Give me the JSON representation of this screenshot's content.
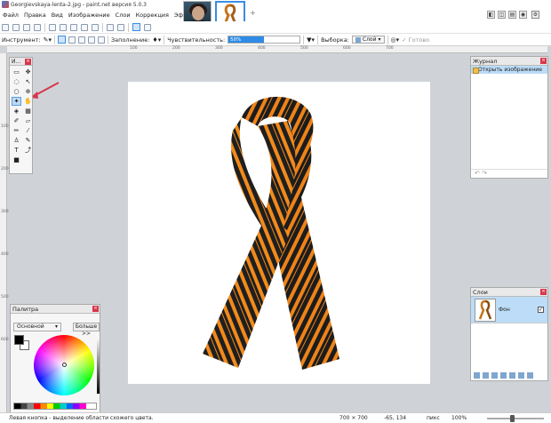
{
  "window": {
    "title": "Georgievskaya-lenta-2.jpg - paint.net версия 5.0.3"
  },
  "menu": {
    "items": [
      "Файл",
      "Правка",
      "Вид",
      "Изображение",
      "Слои",
      "Коррекция",
      "Эффекты"
    ]
  },
  "tabs": {
    "add": "+"
  },
  "toolbar": {
    "tool_label": "Инструмент:",
    "fill_label": "Заполнение:",
    "tolerance_label": "Чувствительность:",
    "tolerance_value": "50%",
    "tolerance_fraction": 0.5,
    "sample_label": "Выборка:",
    "sample_value": "Слой",
    "done_label": "Готово"
  },
  "ruler": {
    "top_ticks": [
      "100",
      "200",
      "300",
      "400",
      "500",
      "600",
      "700"
    ],
    "left_ticks": [
      "100",
      "200",
      "300",
      "400",
      "500",
      "600"
    ]
  },
  "tools_panel": {
    "title": "И..."
  },
  "palette": {
    "title": "Палитра",
    "mode": "Основной",
    "more_button": "Больше >>"
  },
  "history": {
    "title": "Журнал",
    "items": [
      "Открыть изображение"
    ]
  },
  "layers": {
    "title": "Слои",
    "layer_name": "Фон",
    "visible_mark": "✓"
  },
  "status": {
    "hint": "Левая кнопка - выделение области схожего цвета.",
    "size": "700 × 700",
    "coords": "-65, 134",
    "unit": "пикс",
    "zoom": "100%"
  },
  "colors": {
    "accent": "#3a8de0",
    "ribbon_orange": "#f28a1a",
    "ribbon_black": "#1f1f1f",
    "close_red": "#d9364b"
  }
}
